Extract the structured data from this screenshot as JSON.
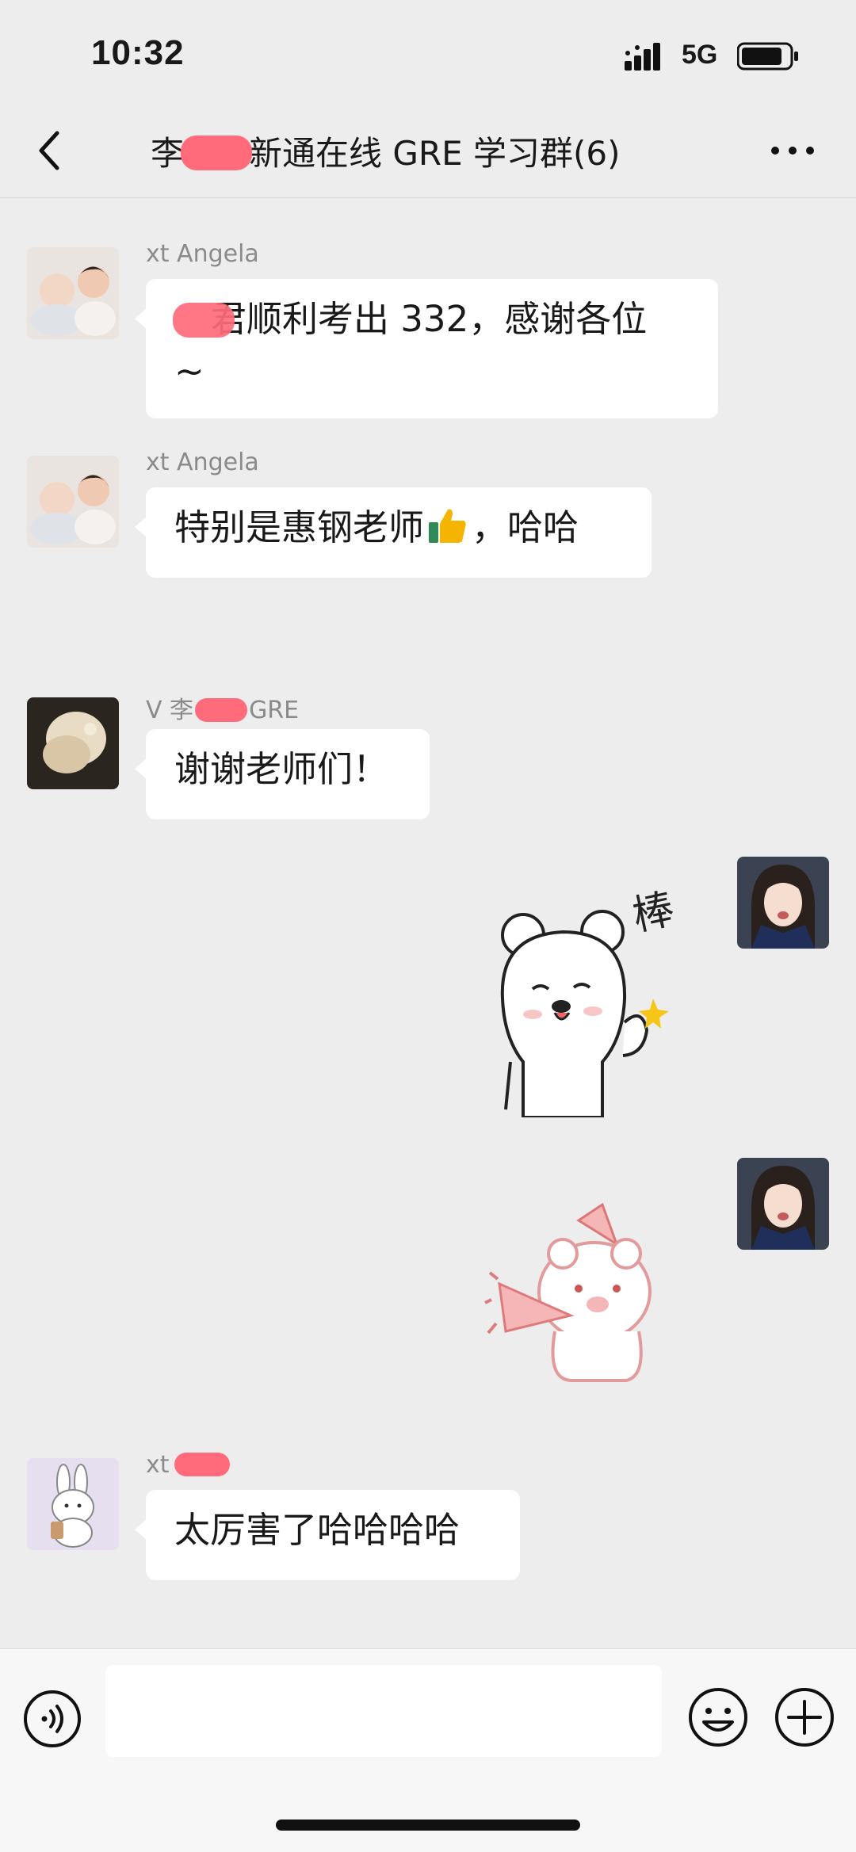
{
  "status_bar": {
    "time": "10:32",
    "network": "5G"
  },
  "header": {
    "title_left": "李",
    "title_right": "新通在线 GRE 学习群(6)"
  },
  "messages": [
    {
      "sender": "xt Angela",
      "text_line1": "君顺利考出 332，感谢各位",
      "text_line2": "~"
    },
    {
      "sender": "xt Angela",
      "text_before": "特别是惠钢老师",
      "text_after": "，哈哈"
    },
    {
      "sender_prefix": "V 李",
      "sender_suffix": "GRE",
      "text": "谢谢老师们！"
    },
    {
      "sticker": "bear-thumbs-up",
      "sticker_text": "棒"
    },
    {
      "sticker": "bear-party-horn"
    },
    {
      "sender_prefix": "xt",
      "text": "太厉害了哈哈哈哈"
    }
  ],
  "input": {
    "placeholder": ""
  },
  "icons": {
    "back": "chevron-left-icon",
    "more": "more-dots-icon",
    "voice": "voice-icon",
    "emoji": "emoji-icon",
    "plus": "plus-icon"
  },
  "colors": {
    "background": "#ededed",
    "bubble": "#ffffff",
    "redaction": "#ff6b7a"
  }
}
